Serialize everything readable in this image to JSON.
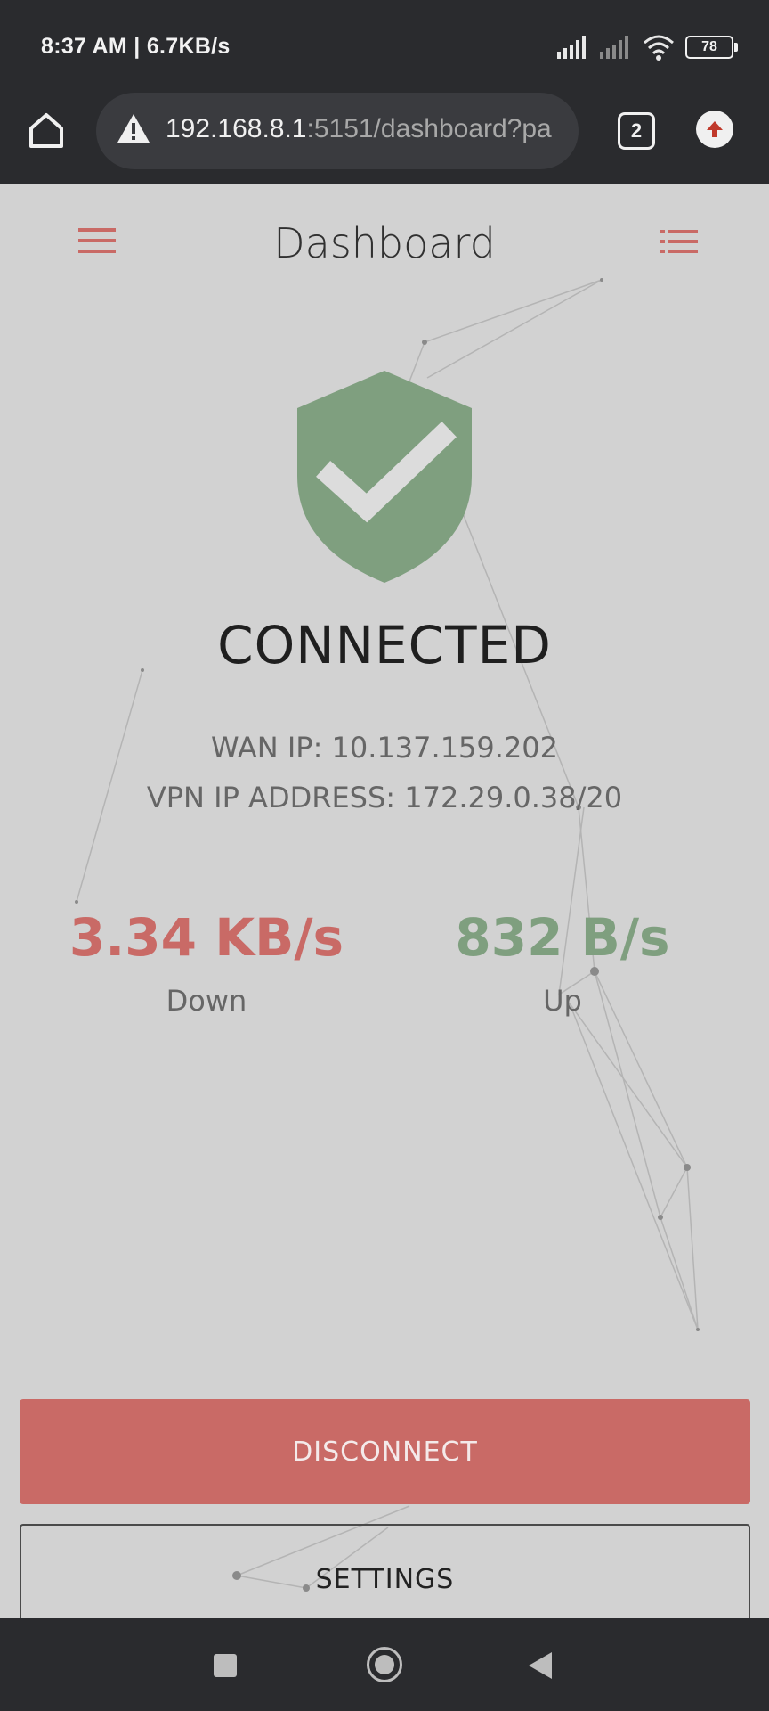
{
  "status_bar": {
    "time_speed": "8:37 AM | 6.7KB/s",
    "battery": "78"
  },
  "browser": {
    "url_host": "192.168.8.1",
    "url_rest": ":5151/dashboard?pa",
    "tab_count": "2"
  },
  "header": {
    "title": "Dashboard"
  },
  "status": {
    "state": "CONNECTED",
    "wan_ip": "WAN IP: 10.137.159.202",
    "vpn_ip": "VPN IP ADDRESS: 172.29.0.38/20",
    "shield_color": "#7f9f7f"
  },
  "speeds": {
    "down_value": "3.34 KB/s",
    "down_label": "Down",
    "down_color": "#c96a66",
    "up_value": "832 B/s",
    "up_label": "Up",
    "up_color": "#7f9f7f"
  },
  "buttons": {
    "disconnect": "DISCONNECT",
    "settings": "SETTINGS"
  }
}
